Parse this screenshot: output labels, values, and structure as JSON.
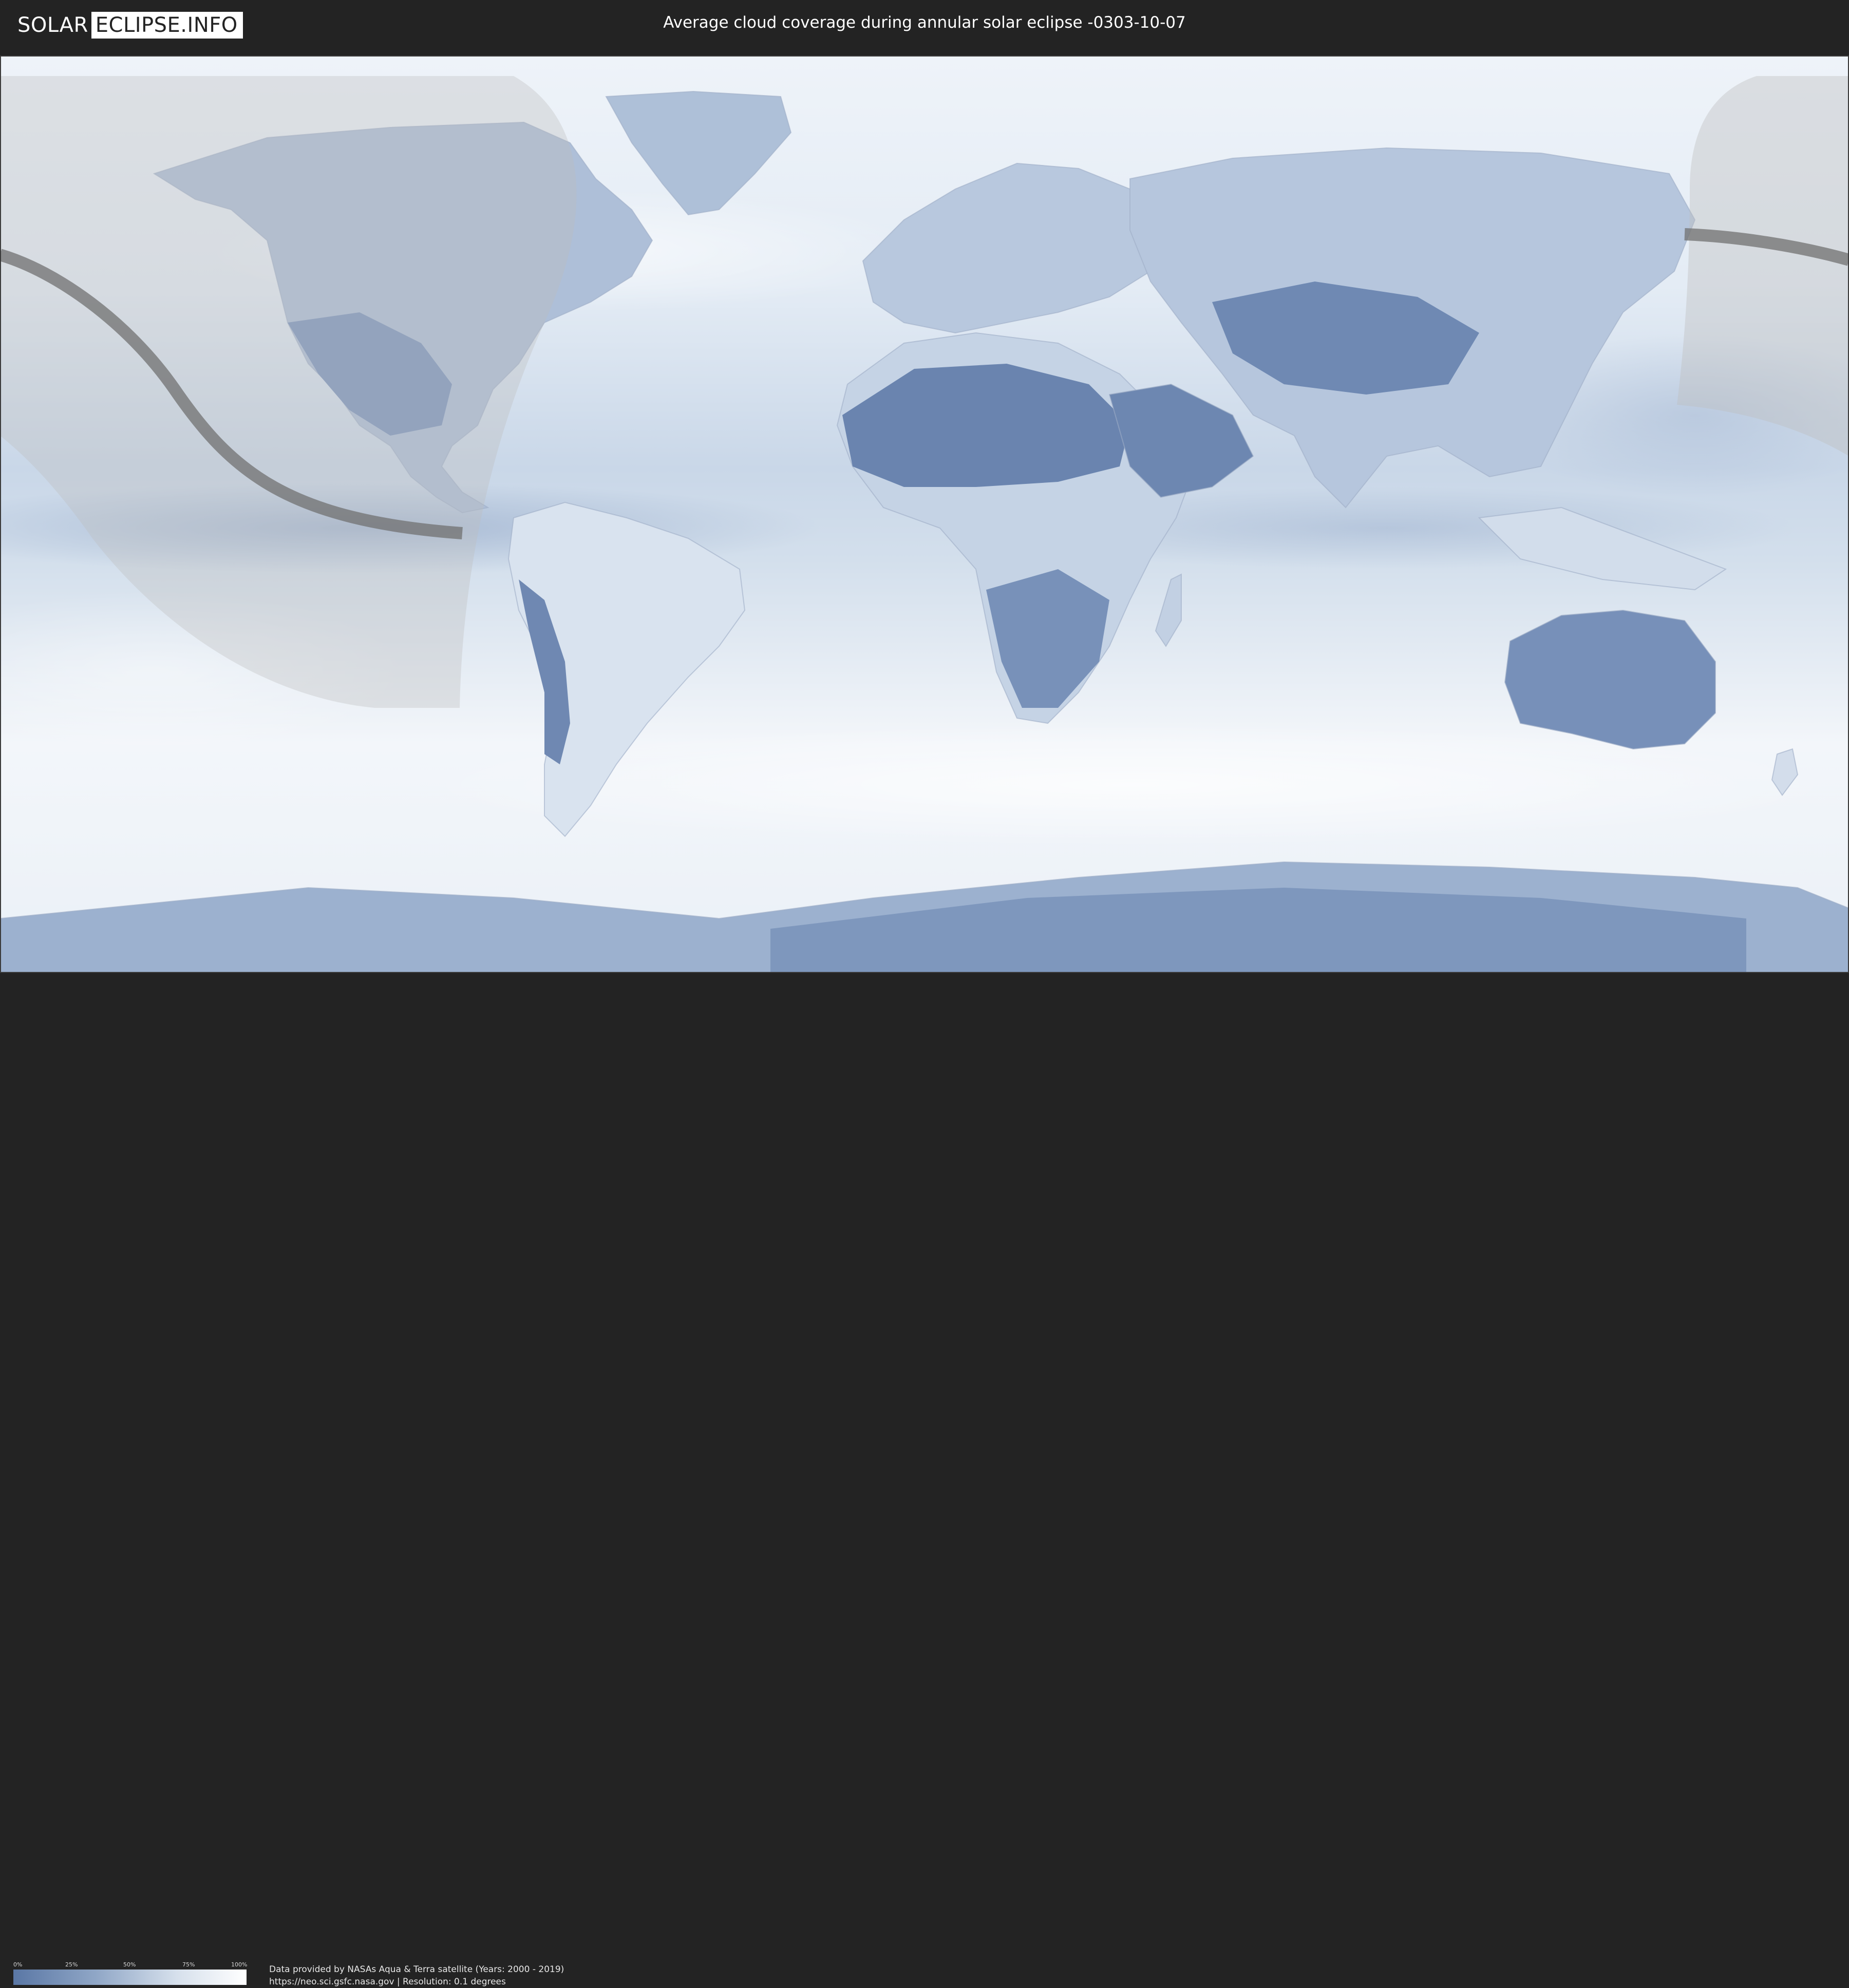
{
  "header": {
    "logo_part1": "SOLAR",
    "logo_part2": "ECLIPSE.INFO",
    "title": "Average cloud coverage during annular solar eclipse -0303-10-07"
  },
  "legend": {
    "ticks": [
      "0%",
      "25%",
      "50%",
      "75%",
      "100%"
    ],
    "color_low": "#5a77a5",
    "color_high": "#ffffff"
  },
  "credits": {
    "line1": "Data provided by NASAs Aqua & Terra satellite (Years: 2000 - 2019)",
    "line2": "https://neo.sci.gsfc.nasa.gov | Resolution: 0.1 degrees"
  },
  "map": {
    "projection": "equirectangular",
    "layer": "average-cloud-coverage",
    "colors": {
      "ocean_base": "#dbe5f0",
      "clear_land": "#6f88b2",
      "cloudy": "#f4f7fb",
      "penumbra": "#bfbfbf",
      "annular_path": "#6c6c6c"
    }
  }
}
